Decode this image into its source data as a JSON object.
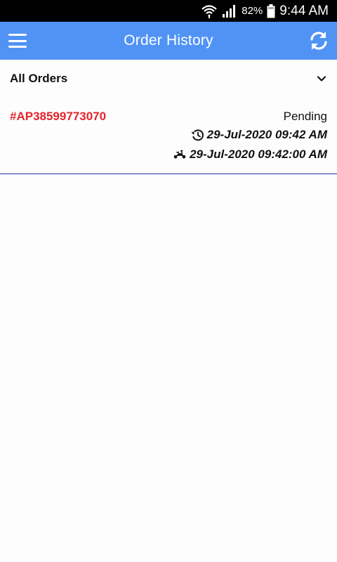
{
  "status_bar": {
    "battery": "82%",
    "time": "9:44 AM"
  },
  "app_bar": {
    "title": "Order History",
    "menu_icon": "hamburger-menu-icon",
    "refresh_icon": "refresh-icon",
    "background_color": "#5093f5"
  },
  "filter": {
    "selected": "All Orders",
    "icon": "chevron-down-icon"
  },
  "orders": [
    {
      "id": "#AP38599773070",
      "status": "Pending",
      "ordered_at": "29-Jul-2020 09:42 AM",
      "delivery_at": "29-Jul-2020 09:42:00 AM",
      "ordered_icon": "history-clock-icon",
      "delivery_icon": "scooter-icon"
    }
  ],
  "colors": {
    "order_id": "#e3242b",
    "divider": "#2a2aa8"
  }
}
